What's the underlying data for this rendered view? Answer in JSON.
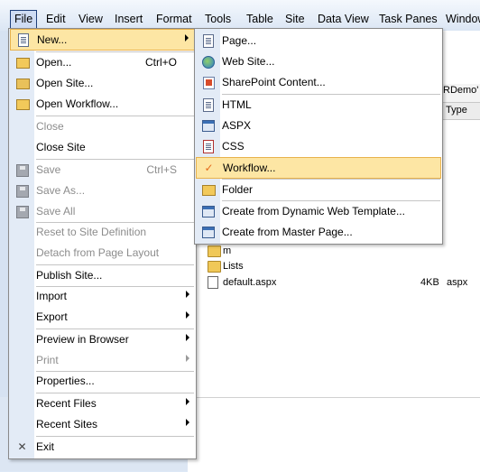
{
  "menubar": {
    "items": [
      "File",
      "Edit",
      "View",
      "Insert",
      "Format",
      "Tools",
      "Table",
      "Site",
      "Data View",
      "Task Panes",
      "Window"
    ]
  },
  "background": {
    "panel_title": "RDemo'",
    "panel_column": "Type",
    "files": [
      {
        "name": "m",
        "size": "",
        "type": "",
        "icon": "folder-icon"
      },
      {
        "name": "Lists",
        "size": "",
        "type": "",
        "icon": "folder-icon"
      },
      {
        "name": "default.aspx",
        "size": "4KB",
        "type": "aspx",
        "icon": "aspx-file-icon"
      }
    ]
  },
  "file_menu": {
    "items": [
      {
        "label": "New...",
        "icon": "new-page-icon",
        "submenu": true,
        "highlighted": true
      },
      {
        "label": "Open...",
        "shortcut": "Ctrl+O",
        "icon": "open-folder-icon"
      },
      {
        "label": "Open Site...",
        "icon": "open-site-icon"
      },
      {
        "label": "Open Workflow...",
        "icon": "open-workflow-icon"
      },
      {
        "label": "Close",
        "disabled": true
      },
      {
        "label": "Close Site"
      },
      {
        "label": "Save",
        "shortcut": "Ctrl+S",
        "icon": "save-icon",
        "disabled": true
      },
      {
        "label": "Save As...",
        "icon": "save-as-icon",
        "disabled": true
      },
      {
        "label": "Save All",
        "icon": "save-all-icon",
        "disabled": true
      },
      {
        "label": "Reset to Site Definition",
        "disabled": true
      },
      {
        "label": "Detach from Page Layout",
        "disabled": true
      },
      {
        "label": "Publish Site..."
      },
      {
        "label": "Import",
        "submenu": true
      },
      {
        "label": "Export",
        "submenu": true
      },
      {
        "label": "Preview in Browser",
        "submenu": true
      },
      {
        "label": "Print",
        "submenu": true,
        "disabled": true
      },
      {
        "label": "Properties..."
      },
      {
        "label": "Recent Files",
        "submenu": true
      },
      {
        "label": "Recent Sites",
        "submenu": true
      },
      {
        "label": "Exit",
        "icon": "exit-icon"
      }
    ]
  },
  "new_submenu": {
    "items": [
      {
        "label": "Page...",
        "icon": "page-icon"
      },
      {
        "label": "Web Site...",
        "icon": "web-site-icon"
      },
      {
        "label": "SharePoint Content...",
        "icon": "sharepoint-icon"
      },
      {
        "label": "HTML",
        "icon": "html-icon"
      },
      {
        "label": "ASPX",
        "icon": "aspx-icon"
      },
      {
        "label": "CSS",
        "icon": "css-icon"
      },
      {
        "label": "Workflow...",
        "icon": "workflow-icon",
        "highlighted": true
      },
      {
        "label": "Folder",
        "icon": "folder-icon"
      },
      {
        "label": "Create from Dynamic Web Template...",
        "icon": "dwt-icon"
      },
      {
        "label": "Create from Master Page...",
        "icon": "master-page-icon"
      }
    ]
  },
  "colors": {
    "highlight": "#fde6a4",
    "highlight_border": "#e8b24d",
    "gutter": "#e3ebf6"
  }
}
